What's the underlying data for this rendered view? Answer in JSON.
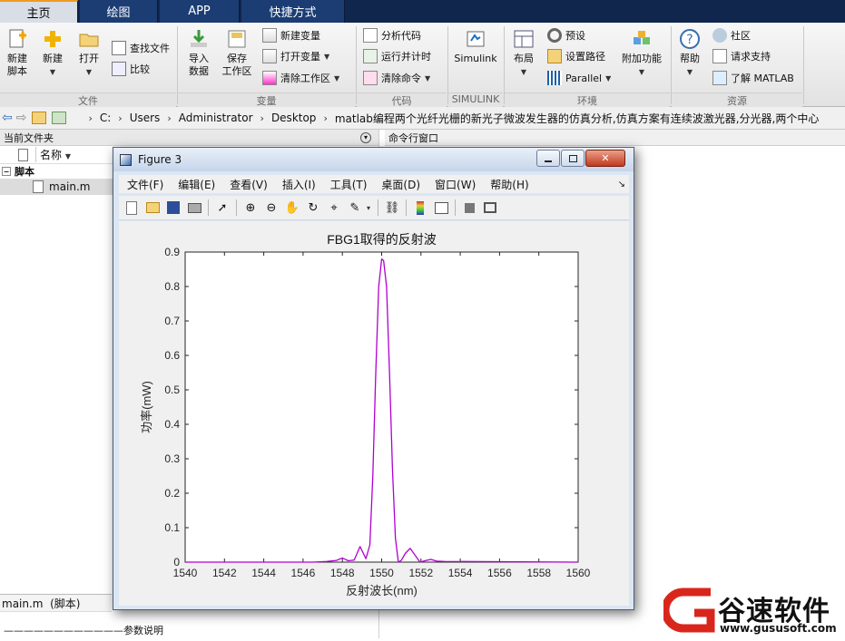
{
  "tabs": [
    {
      "label": "主页",
      "active": true
    },
    {
      "label": "绘图",
      "active": false
    },
    {
      "label": "APP",
      "active": false
    },
    {
      "label": "快捷方式",
      "active": false
    }
  ],
  "ribbon": {
    "file": {
      "title": "文件",
      "new_script": "新建\n脚本",
      "new": "新建",
      "open": "打开",
      "find_files": "查找文件",
      "compare": "比较"
    },
    "variable": {
      "title": "变量",
      "import": "导入\n数据",
      "save_ws": "保存\n工作区",
      "new_var": "新建变量",
      "open_var": "打开变量",
      "clear_ws": "清除工作区"
    },
    "code": {
      "title": "代码",
      "analyze": "分析代码",
      "run_time": "运行并计时",
      "clear_cmd": "清除命令"
    },
    "simulink": {
      "title": "SIMULINK",
      "label": "Simulink"
    },
    "env": {
      "title": "环境",
      "layout": "布局",
      "prefs": "预设",
      "set_path": "设置路径",
      "parallel": "Parallel",
      "addons": "附加功能"
    },
    "resources": {
      "title": "资源",
      "help": "帮助",
      "community": "社区",
      "support": "请求支持",
      "learn": "了解 MATLAB"
    }
  },
  "address": {
    "crumbs": [
      "C:",
      "Users",
      "Administrator",
      "Desktop",
      "matlab编程两个光纤光栅的新光子微波发生器的仿真分析,仿真方案有连续波激光器,分光器,两个中心源"
    ]
  },
  "left_panel": {
    "title": "当前文件夹",
    "col_name": "名称",
    "group": "脚本",
    "file": "main.m",
    "details_title": "main.m  (脚本)",
    "details_text": "————————————参数说明"
  },
  "right_panel": {
    "title": "命令行窗口"
  },
  "figure": {
    "title": "Figure 3",
    "menus": [
      "文件(F)",
      "编辑(E)",
      "查看(V)",
      "插入(I)",
      "工具(T)",
      "桌面(D)",
      "窗口(W)",
      "帮助(H)"
    ]
  },
  "chart_data": {
    "type": "line",
    "title": "FBG1取得的反射波",
    "xlabel": "反射波长(nm)",
    "ylabel": "功率(mW)",
    "xlim": [
      1540,
      1560
    ],
    "ylim": [
      0,
      0.9
    ],
    "xticks": [
      1540,
      1542,
      1544,
      1546,
      1548,
      1550,
      1552,
      1554,
      1556,
      1558,
      1560
    ],
    "yticks": [
      0,
      0.1,
      0.2,
      0.3,
      0.4,
      0.5,
      0.6,
      0.7,
      0.8,
      0.9
    ],
    "grid": false,
    "series": [
      {
        "color": "#b000d0",
        "x": [
          1540,
          1546.5,
          1547.2,
          1547.7,
          1548.0,
          1548.3,
          1548.6,
          1548.9,
          1549.2,
          1549.4,
          1549.55,
          1549.7,
          1549.85,
          1550.0,
          1550.1,
          1550.25,
          1550.4,
          1550.55,
          1550.7,
          1550.85,
          1551.0,
          1551.2,
          1551.45,
          1551.7,
          1551.95,
          1552.2,
          1552.5,
          1552.8,
          1553.2,
          1560
        ],
        "y": [
          0,
          0,
          0.002,
          0.005,
          0.012,
          0.004,
          0.006,
          0.045,
          0.01,
          0.05,
          0.25,
          0.55,
          0.8,
          0.88,
          0.875,
          0.8,
          0.55,
          0.27,
          0.07,
          0.0,
          0.005,
          0.025,
          0.04,
          0.02,
          0.0,
          0.004,
          0.008,
          0.003,
          0.002,
          0
        ]
      }
    ]
  },
  "logo": {
    "cn": "谷速软件",
    "url": "www.gususoft.com"
  },
  "colors": {
    "accent": "#f29a1e",
    "tabbar": "#11264d",
    "line": "#b000d0"
  }
}
